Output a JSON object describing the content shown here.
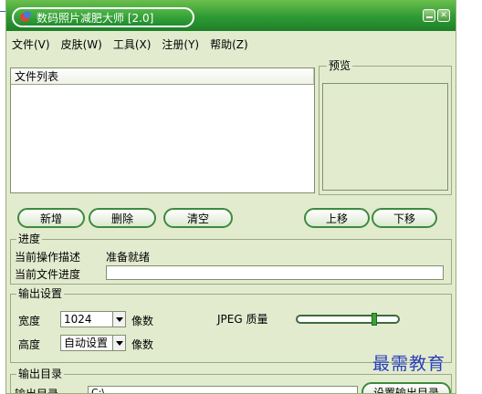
{
  "window": {
    "title": "数码照片减肥大师 [2.0]"
  },
  "titlebar": {
    "minimize_icon": "minimize-icon",
    "close_icon": "close-icon"
  },
  "menu": [
    {
      "label": "文件(V)"
    },
    {
      "label": "皮肤(W)"
    },
    {
      "label": "工具(X)"
    },
    {
      "label": "注册(Y)"
    },
    {
      "label": "帮助(Z)"
    }
  ],
  "file_list": {
    "header": "文件列表"
  },
  "preview": {
    "label": "预览"
  },
  "buttons": {
    "add": "新增",
    "delete": "删除",
    "clear": "清空",
    "move_up": "上移",
    "move_down": "下移"
  },
  "progress": {
    "label": "进度",
    "operation_label": "当前操作描述",
    "operation_status": "准备就绪",
    "file_progress_label": "当前文件进度"
  },
  "output_settings": {
    "label": "输出设置",
    "width_label": "宽度",
    "width_value": "1024",
    "height_label": "高度",
    "height_value": "自动设置",
    "unit": "像数",
    "jpeg_quality_label": "JPEG 质量",
    "jpeg_quality_level": 0.78
  },
  "output_dir": {
    "label": "输出目录",
    "field_label": "输出目录",
    "value": "C:\\",
    "set_button": "设置输出目录"
  },
  "watermark": "最需教育"
}
